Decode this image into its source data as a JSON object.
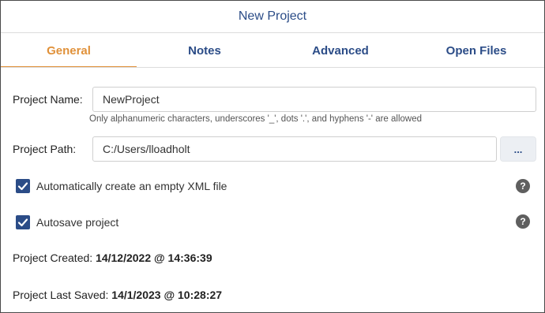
{
  "dialog": {
    "title": "New Project"
  },
  "tabs": [
    {
      "label": "General",
      "active": true
    },
    {
      "label": "Notes",
      "active": false
    },
    {
      "label": "Advanced",
      "active": false
    },
    {
      "label": "Open Files",
      "active": false
    }
  ],
  "form": {
    "project_name": {
      "label": "Project Name:",
      "value": "NewProject",
      "hint": "Only alphanumeric characters, underscores '_', dots '.', and hyphens '-' are allowed"
    },
    "project_path": {
      "label": "Project Path:",
      "value": "C:/Users/lloadholt",
      "browse_label": "..."
    },
    "auto_xml": {
      "label": "Automatically create an empty XML file",
      "checked": true
    },
    "autosave": {
      "label": "Autosave project",
      "checked": true
    }
  },
  "help_icon_glyph": "?",
  "info": {
    "created": {
      "label": "Project Created: ",
      "value": "14/12/2022 @ 14:36:39"
    },
    "last_saved": {
      "label": "Project Last Saved: ",
      "value": "14/1/2023 @ 10:28:27"
    }
  },
  "colors": {
    "accent": "#e0913a",
    "primary": "#2b4c87",
    "help_icon": "#5f5f5f"
  },
  "icons": {
    "checkbox": "check-icon",
    "help": "help-icon"
  }
}
